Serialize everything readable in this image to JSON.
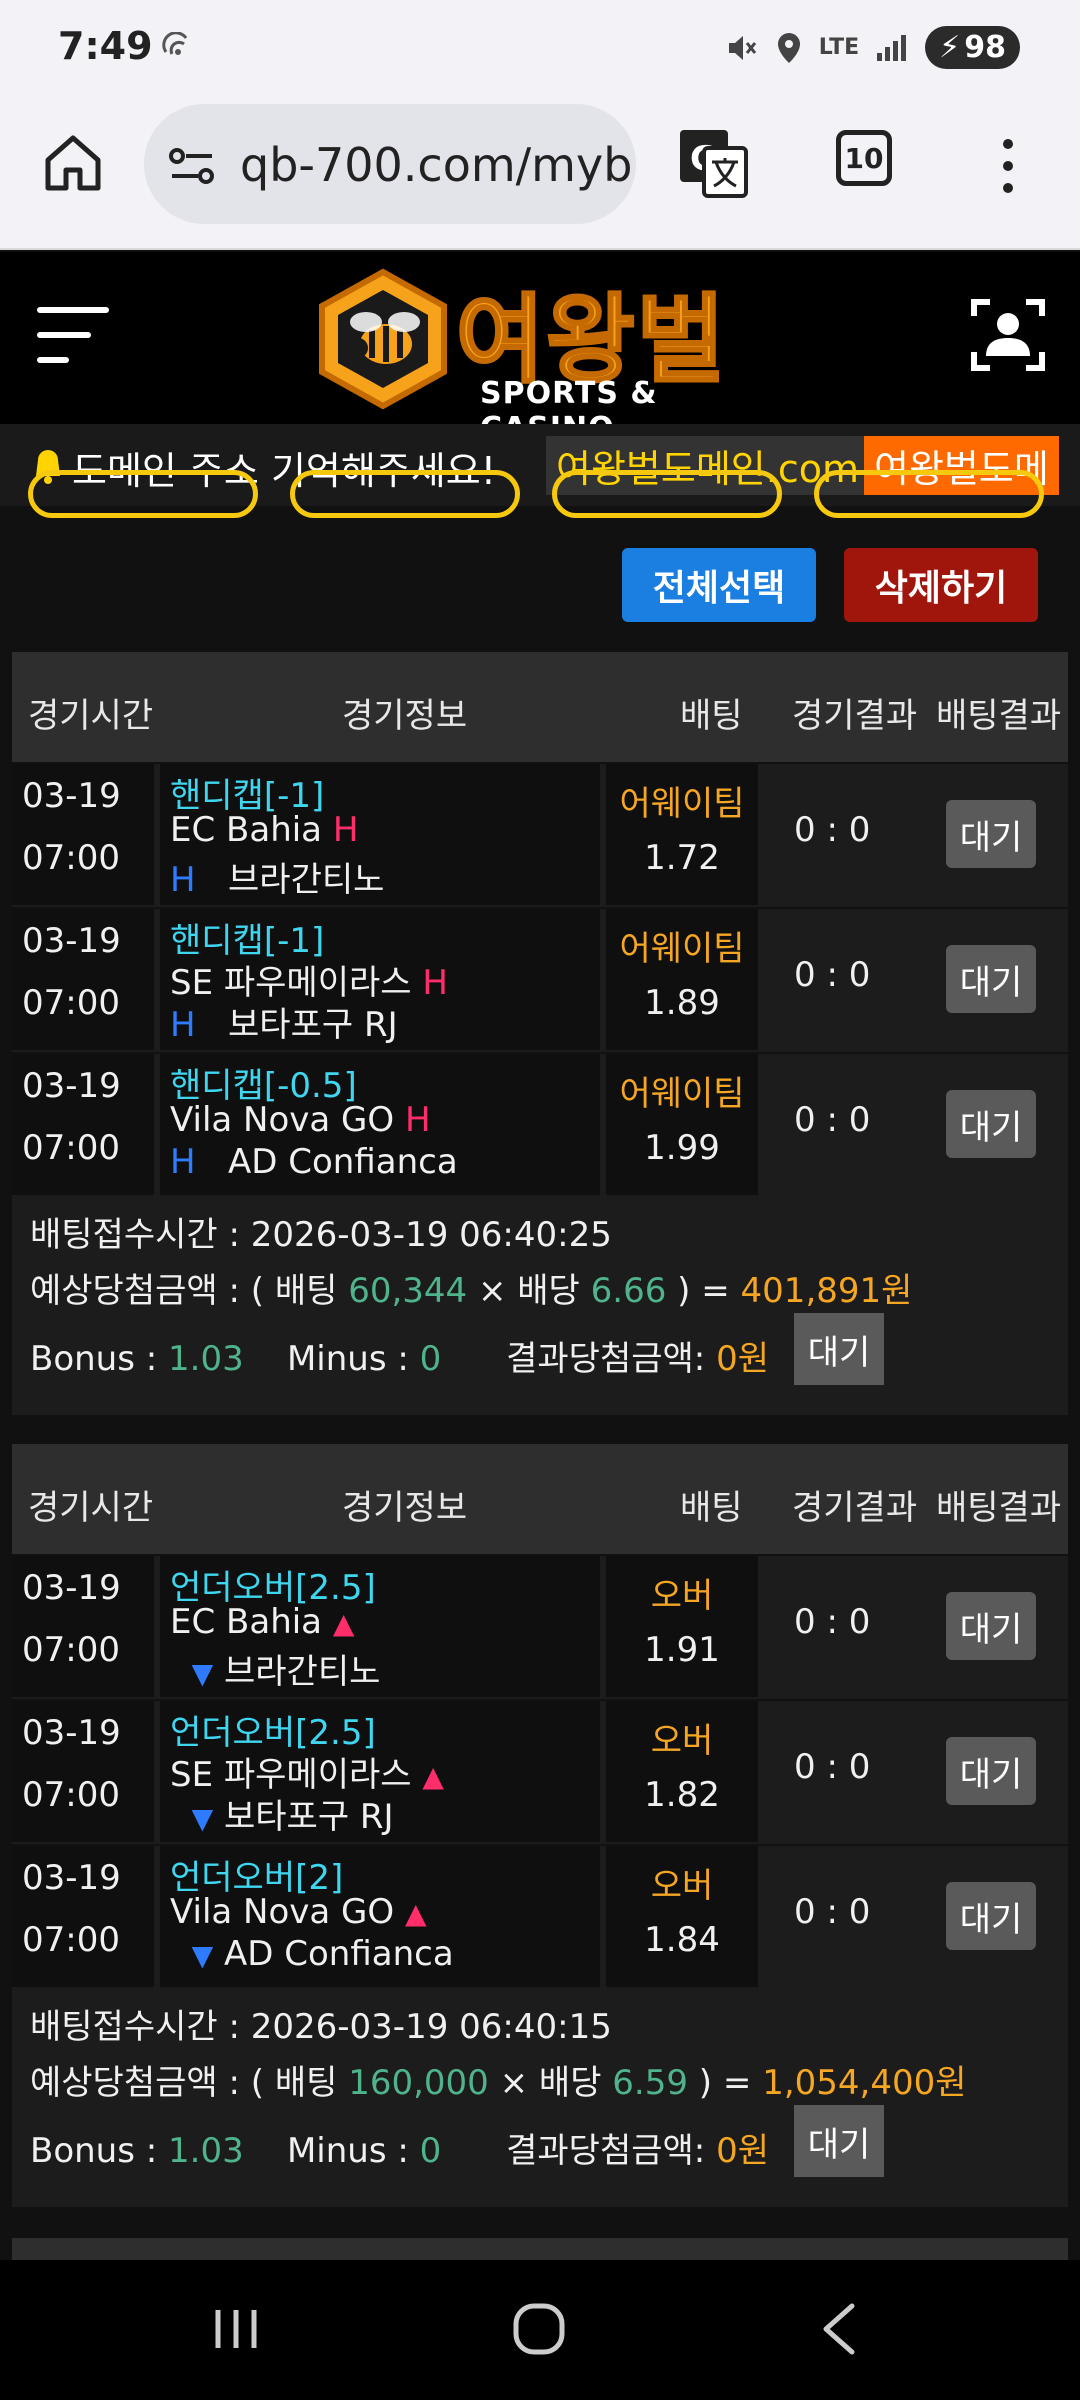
{
  "status": {
    "time": "7:49",
    "battery": "98",
    "network": "LTE"
  },
  "browser": {
    "url": "qb-700.com/myb",
    "tab_count": "10"
  },
  "site": {
    "brand": "여왕벌",
    "tagline": "SPORTS & CASINO"
  },
  "marquee": {
    "text1": "도메인 주소 기억해주세요!",
    "text2": "여왕벌도메인.com",
    "text3": "여왕벌도메"
  },
  "actions": {
    "select_all": "전체선택",
    "delete": "삭제하기"
  },
  "table_headers": [
    "경기시간",
    "경기정보",
    "배팅",
    "경기결과",
    "배팅결과"
  ],
  "bets": [
    {
      "rows": [
        {
          "date": "03-19",
          "time": "07:00",
          "type": "핸디캡[-1]",
          "home": "EC Bahia",
          "away": "브라간티노",
          "pick": "어웨이팀",
          "odds": "1.72",
          "score": "0 : 0",
          "status": "대기"
        },
        {
          "date": "03-19",
          "time": "07:00",
          "type": "핸디캡[-1]",
          "home": "SE 파우메이라스",
          "away": "보타포구 RJ",
          "pick": "어웨이팀",
          "odds": "1.89",
          "score": "0 : 0",
          "status": "대기"
        },
        {
          "date": "03-19",
          "time": "07:00",
          "type": "핸디캡[-0.5]",
          "home": "Vila Nova GO",
          "away": "AD Confianca",
          "pick": "어웨이팀",
          "odds": "1.99",
          "score": "0 : 0",
          "status": "대기"
        }
      ],
      "summary": {
        "received_label": "배팅접수시간 : ",
        "received_time": "2026-03-19 06:40:25",
        "expected_label": "예상당첨금액 : ( 배팅 ",
        "stake": "60,344",
        "times": " × 배당 ",
        "total_odds": "6.66",
        "equals": " ) = ",
        "payout": "401,891원",
        "bonus_label": "Bonus : ",
        "bonus": "1.03",
        "minus_label": "Minus : ",
        "minus": "0",
        "result_label": "결과당첨금액: ",
        "result": "0원",
        "status": "대기"
      }
    },
    {
      "rows": [
        {
          "date": "03-19",
          "time": "07:00",
          "type": "언더오버[2.5]",
          "home": "EC Bahia",
          "away": "브라간티노",
          "pick": "오버",
          "odds": "1.91",
          "score": "0 : 0",
          "status": "대기"
        },
        {
          "date": "03-19",
          "time": "07:00",
          "type": "언더오버[2.5]",
          "home": "SE 파우메이라스",
          "away": "보타포구 RJ",
          "pick": "오버",
          "odds": "1.82",
          "score": "0 : 0",
          "status": "대기"
        },
        {
          "date": "03-19",
          "time": "07:00",
          "type": "언더오버[2]",
          "home": "Vila Nova GO",
          "away": "AD Confianca",
          "pick": "오버",
          "odds": "1.84",
          "score": "0 : 0",
          "status": "대기"
        }
      ],
      "summary": {
        "received_label": "배팅접수시간 : ",
        "received_time": "2026-03-19 06:40:15",
        "expected_label": "예상당첨금액 : ( 배팅 ",
        "stake": "160,000",
        "times": " × 배당 ",
        "total_odds": "6.59",
        "equals": " ) = ",
        "payout": "1,054,400원",
        "bonus_label": "Bonus : ",
        "bonus": "1.03",
        "minus_label": "Minus : ",
        "minus": "0",
        "result_label": "결과당첨금액: ",
        "result": "0원",
        "status": "대기"
      }
    }
  ],
  "markers": {
    "handicap_home": "H",
    "handicap_away": "H",
    "over": "▲",
    "under": "▼"
  }
}
